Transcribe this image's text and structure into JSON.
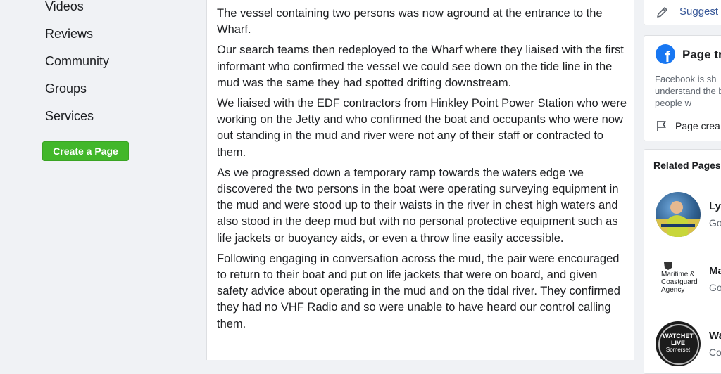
{
  "sidebar": {
    "items": [
      {
        "label": "Videos"
      },
      {
        "label": "Reviews"
      },
      {
        "label": "Community"
      },
      {
        "label": "Groups"
      },
      {
        "label": "Services"
      }
    ],
    "create_page_label": "Create a Page"
  },
  "post": {
    "paragraphs": [
      "The vessel containing two persons was now aground at the entrance to the Wharf.",
      "Our search teams then redeployed to the Wharf where they liaised with the first informant who confirmed the vessel we could see down on the tide line in the mud was the same they had spotted drifting downstream.",
      "We liaised with the EDF contractors from Hinkley Point Power Station who were working on the Jetty and who confirmed the boat and occupants who were now out standing in the mud and river were not any of their staff or contracted to them.",
      "As we progressed down a temporary ramp towards the waters edge we discovered the two persons in the boat were operating surveying equipment in the mud and were stood up to their waists in the river in chest high waters and also stood in the deep mud but with no personal protective equipment such as life jackets or buoyancy aids, or even a throw line easily accessible.",
      "Following engaging in conversation across the mud, the pair were encouraged to return to their boat and put on life jackets that were on board, and given safety advice about operating in the mud and on the tidal river. They confirmed they had no VHF Radio and so were unable to have heard our control calling them."
    ]
  },
  "right": {
    "suggest_label": "Suggest",
    "transparency": {
      "title": "Page tr",
      "text": "Facebook is sh understand the by the people w",
      "link": "Page crea"
    },
    "related": {
      "title": "Related Pages",
      "pages": [
        {
          "name": "Ly",
          "action": "Go"
        },
        {
          "name": "Ma",
          "action": "Go",
          "logo_text": "Maritime & Coastguard Agency"
        },
        {
          "name": "Wa",
          "action": "Co",
          "logo_text": "WATCHET LIVE",
          "logo_sub": "Somerset"
        }
      ]
    }
  },
  "colors": {
    "page_bg": "#f0f2f5",
    "create_button": "#42b72a",
    "link_blue": "#385898",
    "facebook_blue": "#1877f2"
  }
}
